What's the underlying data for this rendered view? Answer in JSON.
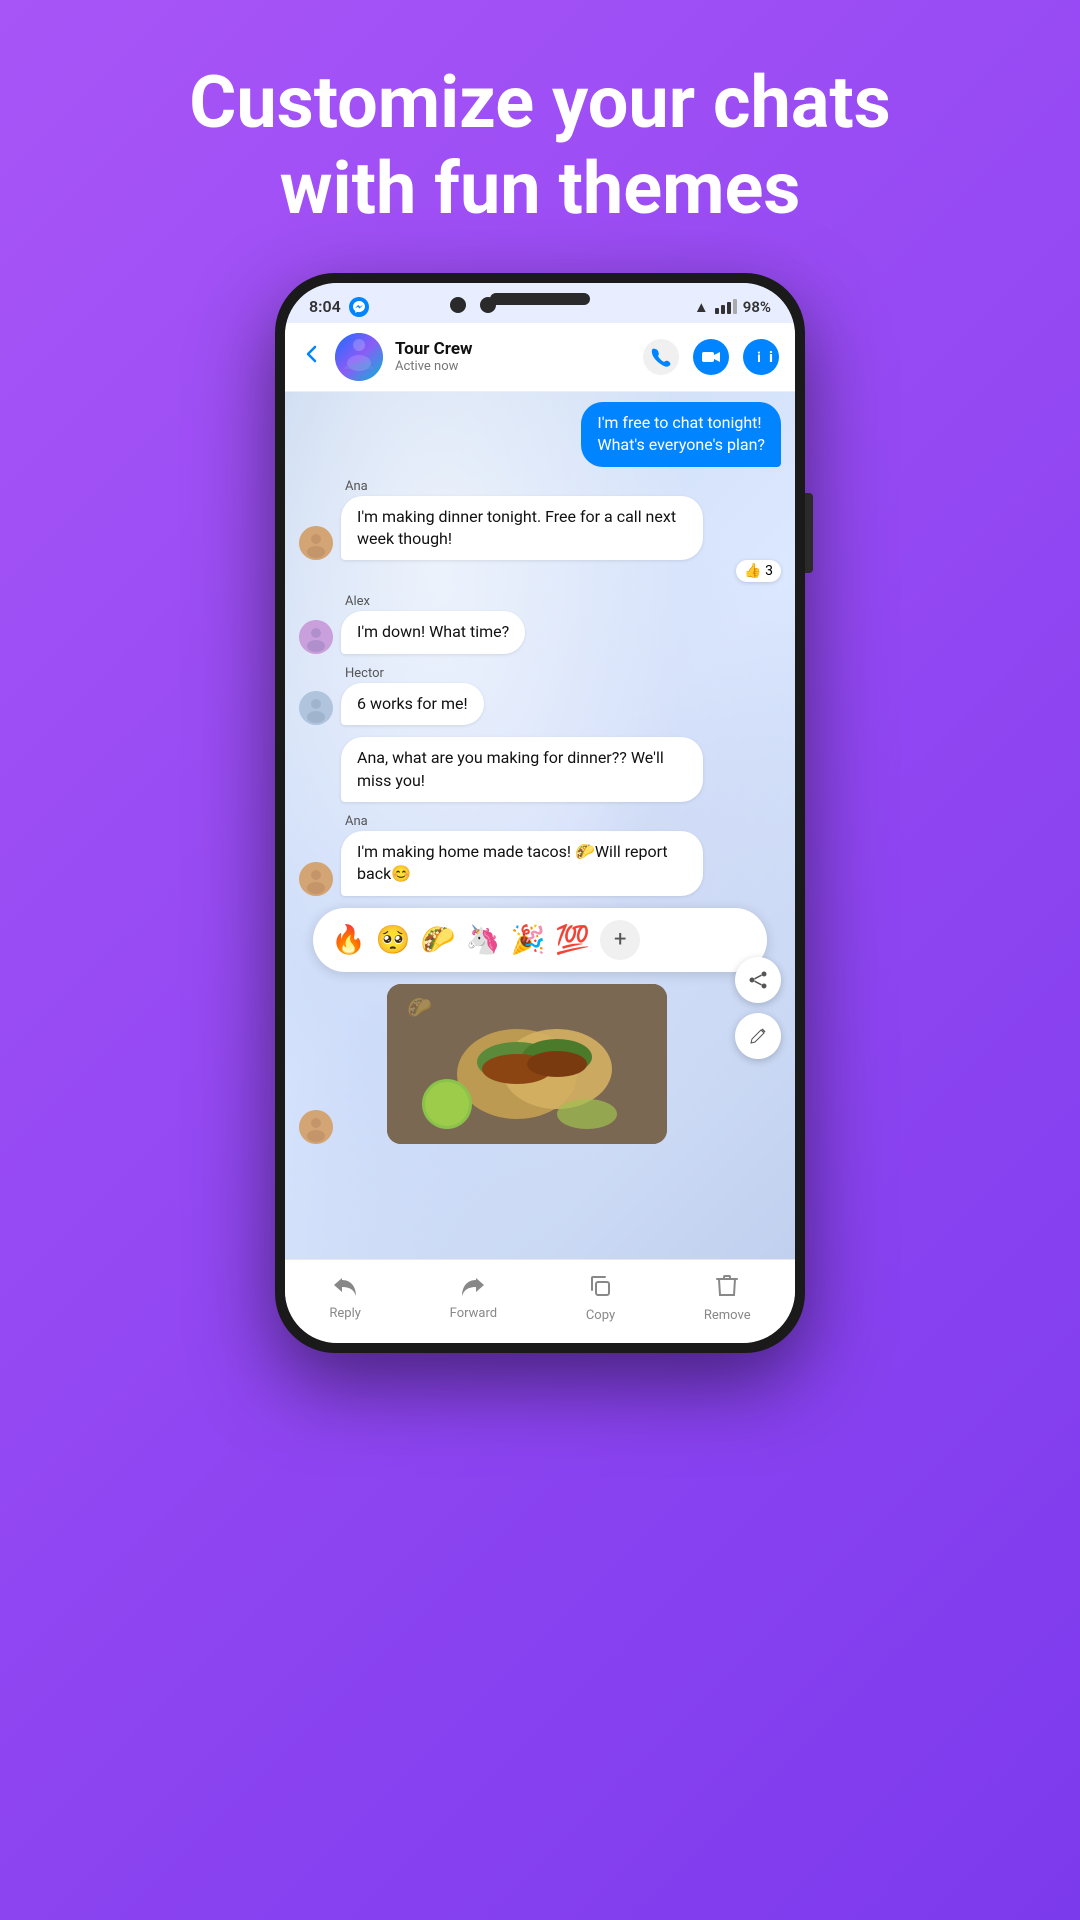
{
  "headline": {
    "line1": "Customize your chats",
    "line2": "with fun themes"
  },
  "status_bar": {
    "time": "8:04",
    "battery": "98%"
  },
  "header": {
    "group_name": "Tour Crew",
    "status": "Active now",
    "back_label": "←"
  },
  "messages": [
    {
      "type": "out",
      "text": "I'm free to chat tonight! What's everyone's plan?"
    },
    {
      "type": "in",
      "sender": "Ana",
      "avatar": "👩",
      "text": "I'm making dinner tonight. Free for a call next week though!",
      "reaction": "👍 3"
    },
    {
      "type": "in",
      "sender": "Alex",
      "avatar": "👩‍🦱",
      "text": "I'm down! What time?"
    },
    {
      "type": "in",
      "sender": "Hector",
      "avatar": "👴",
      "text": "6 works for me!"
    },
    {
      "type": "in",
      "sender": "Hector",
      "avatar": "👴",
      "text": "Ana, what are you making for dinner?? We'll miss you!"
    },
    {
      "type": "in",
      "sender": "Ana",
      "avatar": "👩",
      "text": "I'm making home made tacos! 🌮Will report back😊"
    }
  ],
  "emoji_reactions": [
    "🔥",
    "🥺",
    "🌮",
    "🦄",
    "🎉",
    "💯"
  ],
  "side_actions": [
    "share",
    "edit"
  ],
  "bottom_actions": [
    {
      "icon": "↩",
      "label": "Reply"
    },
    {
      "icon": "↪",
      "label": "Forward"
    },
    {
      "icon": "⧉",
      "label": "Copy"
    },
    {
      "icon": "🗑",
      "label": "Remove"
    }
  ]
}
